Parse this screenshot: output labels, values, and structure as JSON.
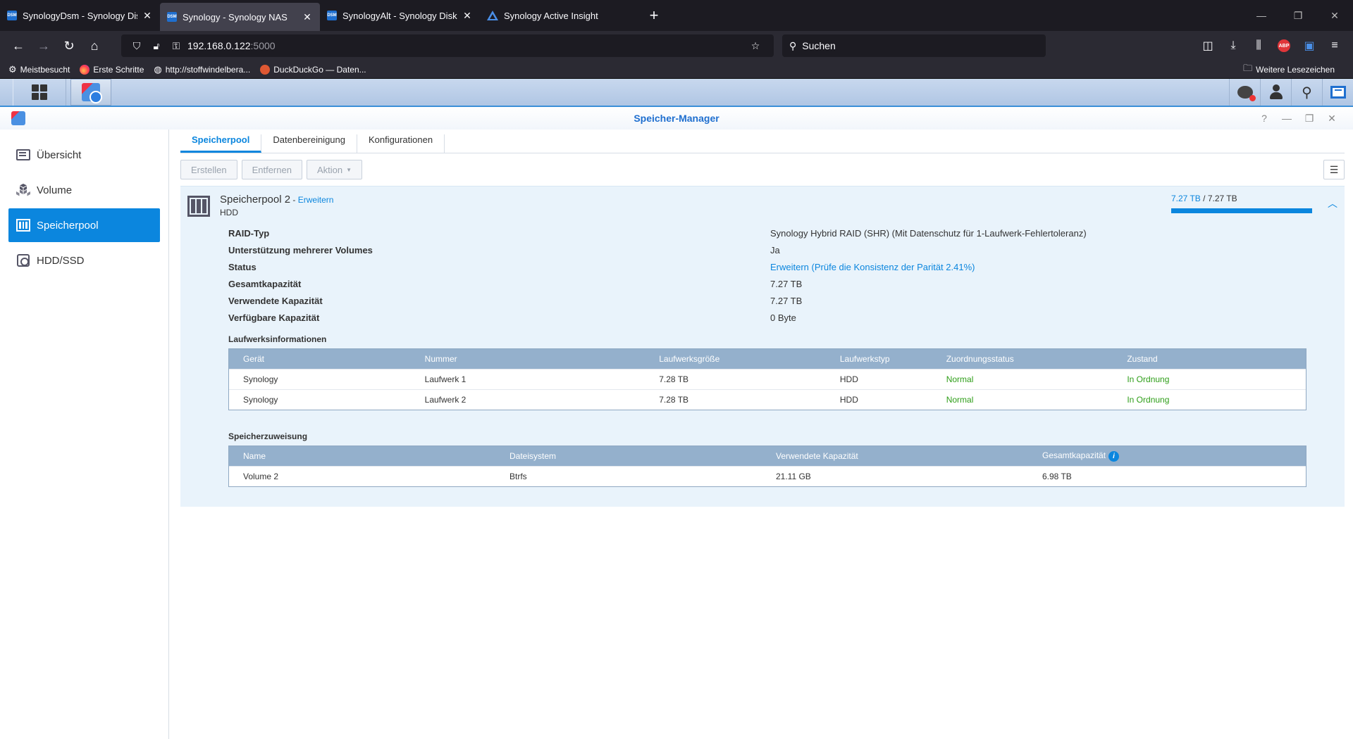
{
  "browser": {
    "tabs": [
      {
        "title": "SynologyDsm - Synology DiskS",
        "favicon": "DSM",
        "active": false
      },
      {
        "title": "Synology - Synology NAS",
        "favicon": "DSM",
        "active": true
      },
      {
        "title": "SynologyAlt - Synology DiskSta",
        "favicon": "DSM",
        "active": false
      },
      {
        "title": "Synology Active Insight",
        "favicon": "triangle",
        "active": false
      }
    ],
    "url_host": "192.168.0.122",
    "url_port": ":5000",
    "search_placeholder": "Suchen",
    "abp_label": "ABP",
    "bookmarks": [
      {
        "label": "Meistbesucht",
        "icon": "gear-icon"
      },
      {
        "label": "Erste Schritte",
        "icon": "firefox-icon"
      },
      {
        "label": "http://stoffwindelbera...",
        "icon": "globe-icon"
      },
      {
        "label": "DuckDuckGo — Daten...",
        "icon": "duckduckgo-icon"
      }
    ],
    "bookmarks_folder": "Weitere Lesezeichen"
  },
  "window": {
    "title": "Speicher-Manager"
  },
  "sidebar": {
    "items": [
      {
        "label": "Übersicht",
        "icon": "overview-icon",
        "active": false
      },
      {
        "label": "Volume",
        "icon": "volume-icon",
        "active": false
      },
      {
        "label": "Speicherpool",
        "icon": "storage-pool-icon",
        "active": true
      },
      {
        "label": "HDD/SSD",
        "icon": "hdd-icon",
        "active": false
      }
    ]
  },
  "tabs": [
    "Speicherpool",
    "Datenbereinigung",
    "Konfigurationen"
  ],
  "toolbar": {
    "create": "Erstellen",
    "remove": "Entfernen",
    "action": "Aktion"
  },
  "pool": {
    "name": "Speicherpool 2",
    "separator": " - ",
    "expand_link": "Erweitern",
    "type": "HDD",
    "used": "7.27 TB",
    "slash": " / ",
    "total": "7.27 TB",
    "usage_fraction": 1.0,
    "properties": [
      {
        "key": "RAID-Typ",
        "value": "Synology Hybrid RAID (SHR) (Mit Datenschutz für 1-Laufwerk-Fehlertoleranz)",
        "link": false
      },
      {
        "key": "Unterstützung mehrerer Volumes",
        "value": "Ja",
        "link": false
      },
      {
        "key": "Status",
        "value": "Erweitern (Prüfe die Konsistenz der Parität 2.41%)",
        "link": true
      },
      {
        "key": "Gesamtkapazität",
        "value": "7.27 TB",
        "link": false
      },
      {
        "key": "Verwendete Kapazität",
        "value": "7.27 TB",
        "link": false
      },
      {
        "key": "Verfügbare Kapazität",
        "value": "0 Byte",
        "link": false
      }
    ]
  },
  "drives": {
    "section_title": "Laufwerksinformationen",
    "headers": [
      "Gerät",
      "Nummer",
      "Laufwerksgröße",
      "Laufwerkstyp",
      "Zuordnungsstatus",
      "Zustand"
    ],
    "rows": [
      [
        "Synology",
        "Laufwerk 1",
        "7.28 TB",
        "HDD",
        "Normal",
        "In Ordnung"
      ],
      [
        "Synology",
        "Laufwerk 2",
        "7.28 TB",
        "HDD",
        "Normal",
        "In Ordnung"
      ]
    ],
    "status_color": "#2e9e18"
  },
  "allocation": {
    "section_title": "Speicherzuweisung",
    "headers": [
      "Name",
      "Dateisystem",
      "Verwendete Kapazität",
      "Gesamtkapazität"
    ],
    "rows": [
      [
        "Volume 2",
        "Btrfs",
        "21.11 GB",
        "6.98 TB"
      ]
    ]
  },
  "colors": {
    "accent": "#0b86de",
    "table_header": "#94b0cc",
    "pool_bg": "#e9f3fb"
  }
}
